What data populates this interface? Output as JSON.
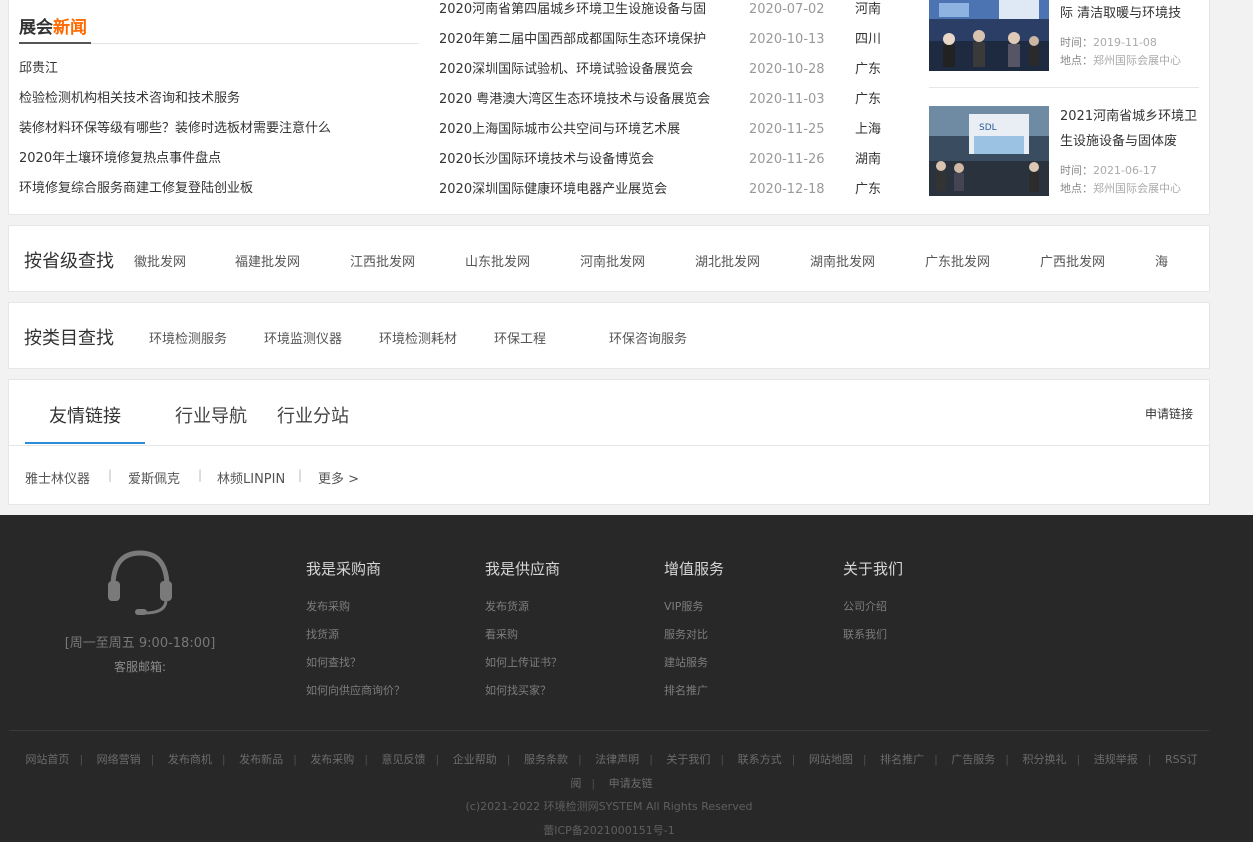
{
  "news": {
    "title_a": "展会",
    "title_b": "新闻",
    "items": [
      "邱贵江",
      "检验检测机构相关技术咨询和技术服务",
      "装修材料环保等级有哪些？装修时选板材需要注意什么",
      "2020年土壤环境修复热点事件盘点",
      "环境修复综合服务商建工修复登陆创业板"
    ]
  },
  "expos": [
    {
      "title": "2020河南省第四届城乡环境卫生设施设备与固",
      "date": "2020-07-02",
      "place": "河南"
    },
    {
      "title": "2020年第二届中国西部成都国际生态环境保护",
      "date": "2020-10-13",
      "place": "四川"
    },
    {
      "title": "2020深圳国际试验机、环境试验设备展览会",
      "date": "2020-10-28",
      "place": "广东"
    },
    {
      "title": "2020 粤港澳大湾区生态环境技术与设备展览会",
      "date": "2020-11-03",
      "place": "广东"
    },
    {
      "title": "2020上海国际城市公共空间与环境艺术展",
      "date": "2020-11-25",
      "place": "上海"
    },
    {
      "title": "2020长沙国际环境技术与设备博览会",
      "date": "2020-11-26",
      "place": "湖南"
    },
    {
      "title": "2020深圳国际健康环境电器产业展览会",
      "date": "2020-12-18",
      "place": "广东"
    }
  ],
  "featured": [
    {
      "title": "际 清洁取暖与环境技",
      "time_label": "时间：",
      "time": "2019-11-08",
      "place_label": "地点：",
      "place": "郑州国际会展中心"
    },
    {
      "title": "2021河南省城乡环境卫生设施设备与固体废",
      "time_label": "时间：",
      "time": "2021-06-17",
      "place_label": "地点：",
      "place": "郑州国际会展中心"
    }
  ],
  "province": {
    "title": "按省级查找",
    "links": [
      "徽批发网",
      "福建批发网",
      "江西批发网",
      "山东批发网",
      "河南批发网",
      "湖北批发网",
      "湖南批发网",
      "广东批发网",
      "广西批发网",
      "海"
    ]
  },
  "category": {
    "title": "按类目查找",
    "links": [
      "环境检测服务",
      "环境监测仪器",
      "环境检测耗材",
      "环保工程",
      "环保咨询服务"
    ]
  },
  "links_block": {
    "tabs": [
      "友情链接",
      "行业导航",
      "行业分站"
    ],
    "apply": "申请链接",
    "friends": [
      "雅士林仪器",
      "爱斯佩克",
      "林频LINPIN",
      "更多 >"
    ],
    "sep": "|"
  },
  "footer": {
    "service_hours": "[周一至周五 9:00-18:00]",
    "service_email": "客服邮箱:",
    "columns": [
      {
        "title": "我是采购商",
        "links": [
          "发布采购",
          "找货源",
          "如何查找？",
          "如何向供应商询价？"
        ]
      },
      {
        "title": "我是供应商",
        "links": [
          "发布货源",
          "看采购",
          "如何上传证书？",
          "如何找买家？"
        ]
      },
      {
        "title": "增值服务",
        "links": [
          "VIP服务",
          "服务对比",
          "建站服务",
          "排名推广"
        ]
      },
      {
        "title": "关于我们",
        "links": [
          "公司介绍",
          "联系我们"
        ]
      }
    ],
    "nav": [
      "网站首页",
      "网络营销",
      "发布商机",
      "发布新品",
      "发布采购",
      "意见反馈",
      "企业帮助",
      "服务条款",
      "法律声明",
      "关于我们",
      "联系方式",
      "网站地图",
      "排名推广",
      "广告服务",
      "积分换礼",
      "违规举报",
      "RSS订阅",
      "申请友链"
    ],
    "copyright": "(c)2021-2022 环境检测网SYSTEM All Rights Reserved",
    "icp": "蕾ICP备2021000151号-1"
  },
  "icons": {
    "headset": "headset-icon"
  },
  "colors": {
    "accent": "#ff6a00",
    "tab_active": "#2a8fd8",
    "footer_bg": "#282828"
  }
}
